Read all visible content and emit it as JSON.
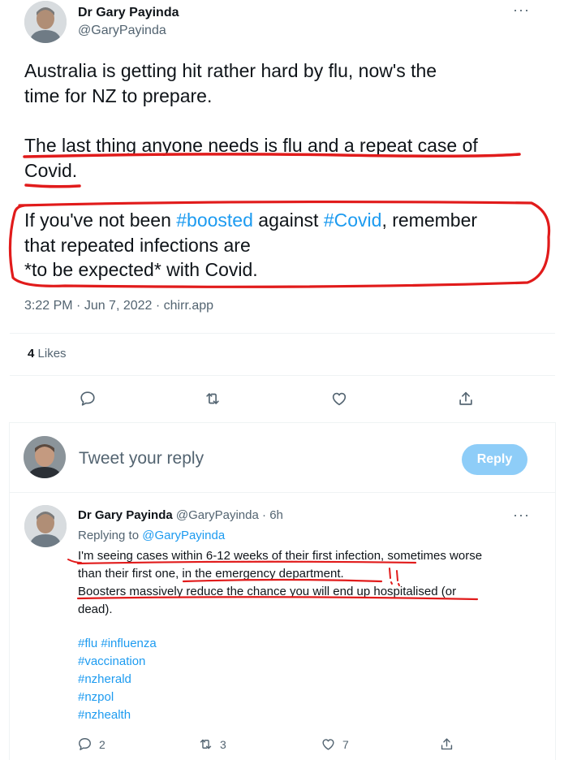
{
  "main_tweet": {
    "author_name": "Dr Gary Payinda",
    "author_handle": "@GaryPayinda",
    "more_icon": "more-icon",
    "line1": "Australia is getting hit rather hard by flu, now's the",
    "line2": "time for NZ to prepare.",
    "line3": "The last thing anyone needs is flu and a repeat case of",
    "line4": "Covid.",
    "line5_pre": "If you've not been ",
    "line5_tag1": "#boosted",
    "line5_mid": " against ",
    "line5_tag2": "#Covid",
    "line5_post": ", remember",
    "line6": "that repeated infections are",
    "line7": "*to be expected* with Covid.",
    "time": "3:22 PM",
    "date": "Jun 7, 2022",
    "source": "chirr.app",
    "likes_count": "4",
    "likes_label": "Likes"
  },
  "composer": {
    "placeholder": "Tweet your reply",
    "button_label": "Reply"
  },
  "reply_tweet": {
    "author_name": "Dr Gary Payinda",
    "author_handle": "@GaryPayinda",
    "age": "6h",
    "replying_label": "Replying to",
    "replying_handle": "@GaryPayinda",
    "line1": "I'm seeing cases within 6-12 weeks of their first infection, sometimes worse",
    "line2": "than their first one, in the emergency department.",
    "line3": "Boosters massively reduce the chance you will end up hospitalised (or",
    "line4": "dead).",
    "hashtags": [
      "#flu #influenza",
      "#vaccination",
      "#nzherald",
      "#nzpol",
      "#nzhealth"
    ],
    "reply_count": "2",
    "retweet_count": "3",
    "like_count": "7"
  },
  "colors": {
    "link": "#1d9bf0",
    "muted": "#536471",
    "annotation": "#e11b1b",
    "reply_button": "#8ecdf8"
  }
}
